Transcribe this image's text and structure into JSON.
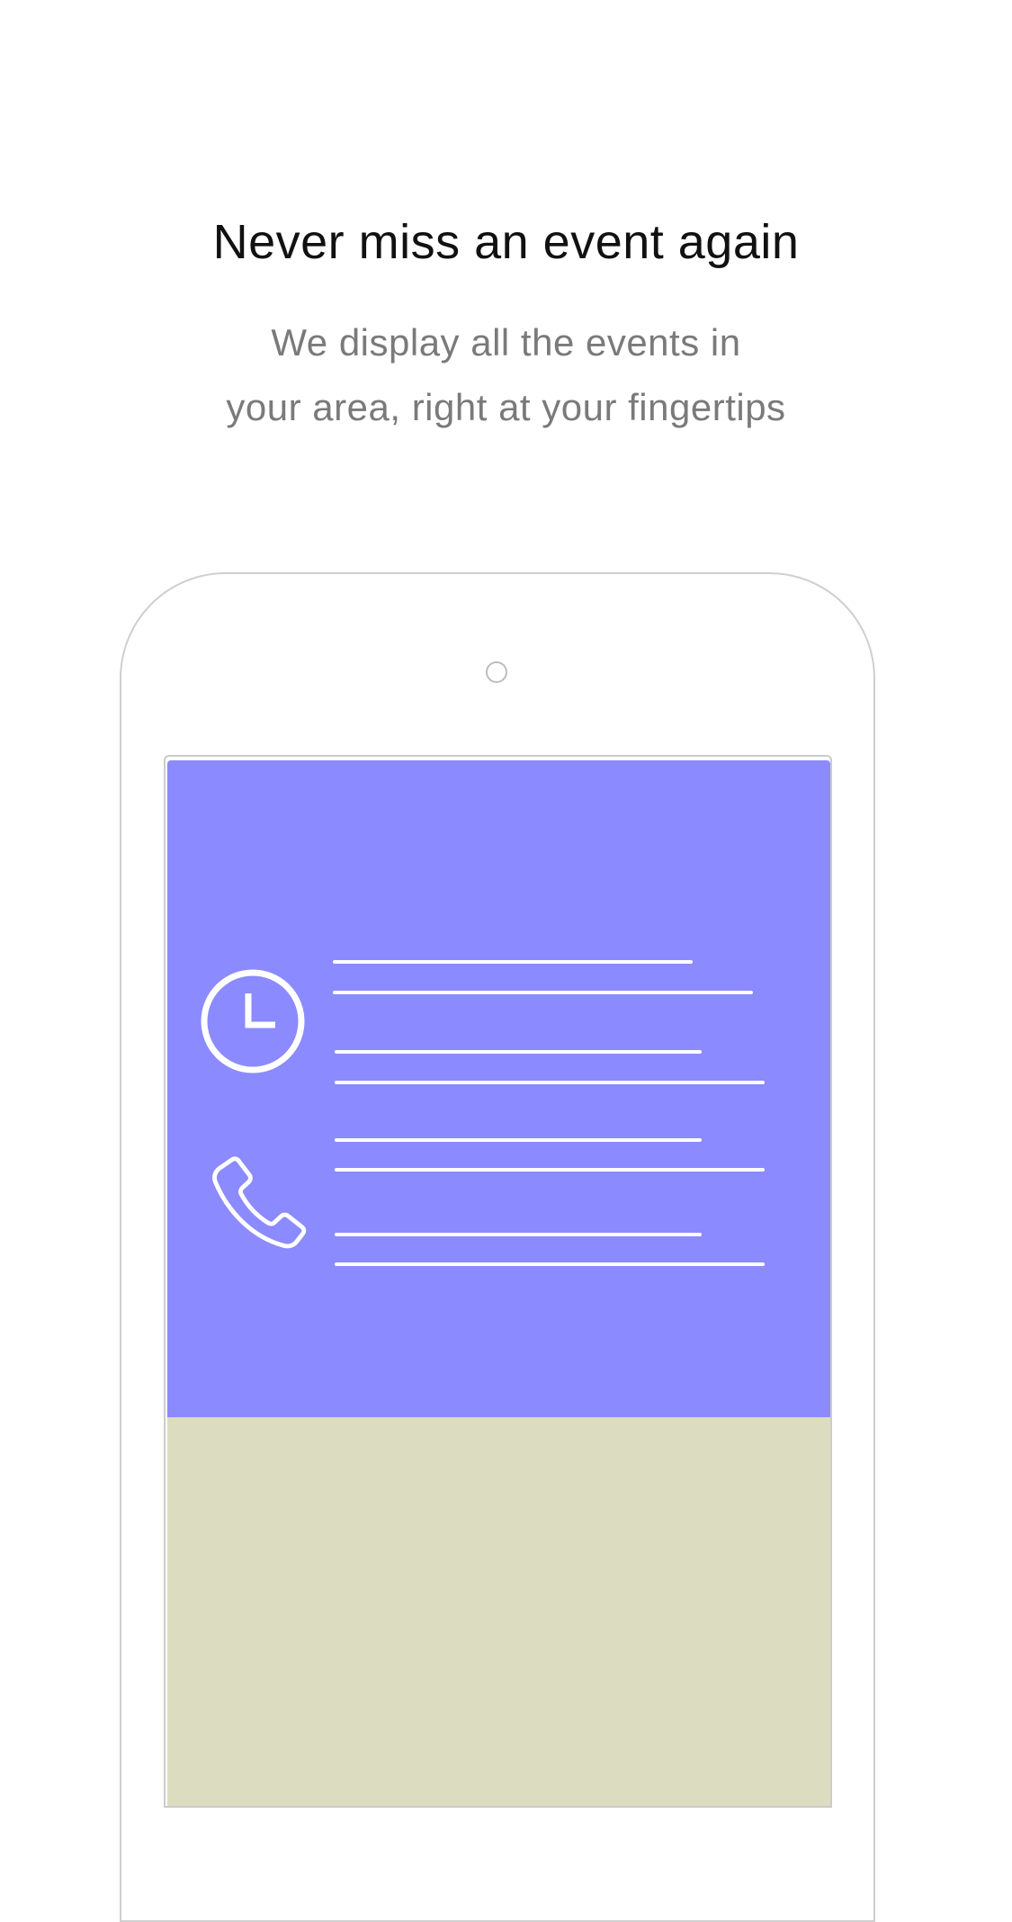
{
  "onboarding": {
    "title": "Never miss an event again",
    "subtitle_lines": [
      "We display all the events in",
      "your area, right at your fingertips"
    ]
  },
  "illustration": {
    "icons": [
      "clock-icon",
      "phone-icon"
    ],
    "colors": {
      "top_panel": "#8b8aff",
      "bottom_panel": "#dcdcc0",
      "device_outline": "#cfcfcf"
    }
  }
}
